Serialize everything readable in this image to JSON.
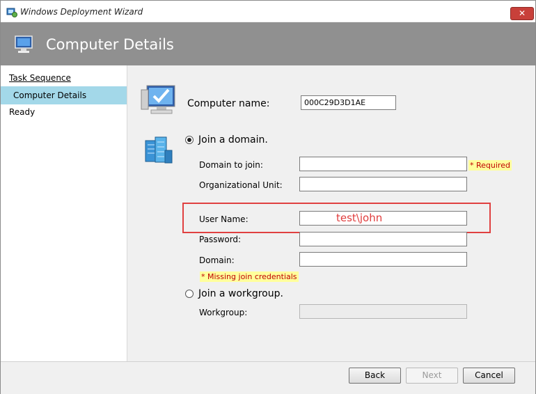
{
  "window": {
    "title": "Windows Deployment Wizard",
    "close_glyph": "✕"
  },
  "banner": {
    "title": "Computer Details"
  },
  "sidebar": {
    "items": [
      {
        "label": "Task Sequence"
      },
      {
        "label": "Computer Details"
      },
      {
        "label": "Ready"
      }
    ]
  },
  "form": {
    "computer_name_label": "Computer name:",
    "computer_name_value": "000C29D3D1AE",
    "join_domain_label": "Join a domain.",
    "join_domain_selected": true,
    "domain_to_join_label": "Domain to join:",
    "domain_to_join_value": "",
    "required_note": "* Required",
    "org_unit_label": "Organizational Unit:",
    "org_unit_value": "",
    "user_name_label": "User Name:",
    "user_name_value": "test\\john",
    "password_label": "Password:",
    "password_value": "",
    "domain_label": "Domain:",
    "domain_value": "",
    "missing_credentials_note": "* Missing join credentials",
    "join_workgroup_label": "Join a workgroup.",
    "join_workgroup_selected": false,
    "workgroup_label": "Workgroup:",
    "workgroup_value": ""
  },
  "footer": {
    "back_label": "Back",
    "next_label": "Next",
    "cancel_label": "Cancel"
  },
  "colors": {
    "banner": "#909090",
    "selected_nav": "#a3d8e9",
    "highlight_box": "#e04040",
    "annotation_text": "#e03c3c",
    "note_bg": "#ffff9c",
    "note_text": "#c00000"
  }
}
